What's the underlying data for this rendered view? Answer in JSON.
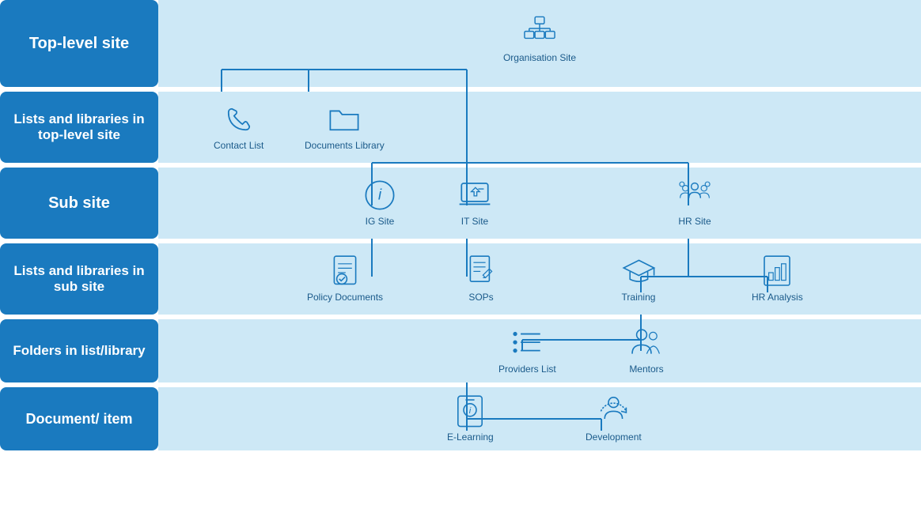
{
  "labels": {
    "topSite": "Top-level site",
    "listsTop": "Lists and libraries in top-level site",
    "subSite": "Sub site",
    "listsSub": "Lists and libraries in sub site",
    "folders": "Folders in list/library",
    "docItem": "Document/ item"
  },
  "items": {
    "orgSite": "Organisation Site",
    "contactList": "Contact List",
    "documentsLibrary": "Documents Library",
    "igSite": "IG Site",
    "itSite": "IT Site",
    "hrSite": "HR Site",
    "policyDocuments": "Policy Documents",
    "sops": "SOPs",
    "training": "Training",
    "hrAnalysis": "HR Analysis",
    "providersList": "Providers List",
    "mentors": "Mentors",
    "eLearning": "E-Learning",
    "development": "Development"
  },
  "colors": {
    "labelBg": "#1a7abf",
    "contentBg": "#cde8f6",
    "labelText": "#ffffff",
    "iconColor": "#1a7abf",
    "lineColor": "#1a7abf"
  }
}
